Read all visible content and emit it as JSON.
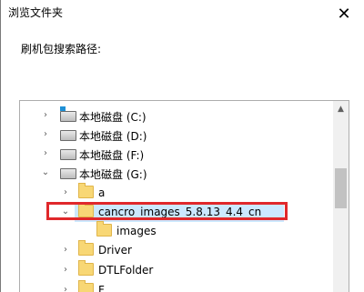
{
  "window": {
    "title": "浏览文件夹",
    "close_glyph": "✕"
  },
  "prompt": {
    "label": "刷机包搜索路径:"
  },
  "tree": {
    "items": [
      {
        "label": "本地磁盘 (C:)",
        "icon": "system-drive-icon",
        "expander": "›"
      },
      {
        "label": "本地磁盘 (D:)",
        "icon": "drive-icon",
        "expander": "›"
      },
      {
        "label": "本地磁盘 (F:)",
        "icon": "drive-icon",
        "expander": "›"
      },
      {
        "label": "本地磁盘 (G:)",
        "icon": "drive-icon",
        "expander": "⌄"
      },
      {
        "label": "a",
        "icon": "folder-icon",
        "expander": "›"
      },
      {
        "label": "cancro_images_5.8.13_4.4_cn",
        "icon": "folder-icon",
        "expander": "⌄",
        "selected": true
      },
      {
        "label": "images",
        "icon": "folder-icon",
        "expander": ""
      },
      {
        "label": "Driver",
        "icon": "folder-icon",
        "expander": "›"
      },
      {
        "label": "DTLFolder",
        "icon": "folder-icon",
        "expander": "›"
      },
      {
        "label": "F",
        "icon": "folder-icon",
        "expander": "›"
      }
    ]
  },
  "colors": {
    "highlight_box": "#e0282b",
    "selection": "#cce8ff",
    "folder": "#f8d775"
  }
}
